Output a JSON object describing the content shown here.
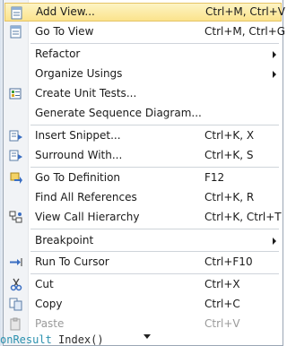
{
  "menu": {
    "items": [
      {
        "label": "Add View...",
        "shortcut": "Ctrl+M, Ctrl+V",
        "icon": "add-view-icon",
        "highlighted": true
      },
      {
        "label": "Go To View",
        "shortcut": "Ctrl+M, Ctrl+G",
        "icon": "go-to-view-icon"
      },
      {
        "label": "Refactor",
        "shortcut": "",
        "submenu": true
      },
      {
        "label": "Organize Usings",
        "shortcut": "",
        "submenu": true
      },
      {
        "label": "Create Unit Tests...",
        "shortcut": "",
        "icon": "unit-tests-icon"
      },
      {
        "label": "Generate Sequence Diagram...",
        "shortcut": ""
      },
      {
        "label": "Insert Snippet...",
        "shortcut": "Ctrl+K, X",
        "icon": "insert-snippet-icon"
      },
      {
        "label": "Surround With...",
        "shortcut": "Ctrl+K, S",
        "icon": "surround-with-icon"
      },
      {
        "label": "Go To Definition",
        "shortcut": "F12",
        "icon": "go-to-definition-icon"
      },
      {
        "label": "Find All References",
        "shortcut": "Ctrl+K, R"
      },
      {
        "label": "View Call Hierarchy",
        "shortcut": "Ctrl+K, Ctrl+T",
        "icon": "call-hierarchy-icon"
      },
      {
        "label": "Breakpoint",
        "shortcut": "",
        "submenu": true
      },
      {
        "label": "Run To Cursor",
        "shortcut": "Ctrl+F10",
        "icon": "run-to-cursor-icon"
      },
      {
        "label": "Cut",
        "shortcut": "Ctrl+X",
        "icon": "cut-icon"
      },
      {
        "label": "Copy",
        "shortcut": "Ctrl+C",
        "icon": "copy-icon"
      },
      {
        "label": "Paste",
        "shortcut": "Ctrl+V",
        "icon": "paste-icon",
        "disabled": true
      }
    ]
  },
  "editor": {
    "code_left": "onResult",
    "code_right": "Index()"
  }
}
